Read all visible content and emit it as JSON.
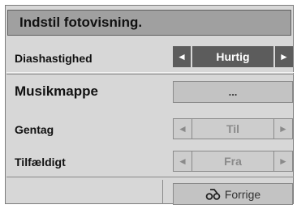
{
  "dialog": {
    "title": "Indstil fotovisning.",
    "slideshow_speed": {
      "label": "Diashastighed",
      "value": "Hurtig",
      "left_arrow": "◄",
      "right_arrow": "►"
    },
    "music_folder": {
      "label": "Musikmappe",
      "button_label": "..."
    },
    "repeat": {
      "label": "Gentag",
      "value": "Til",
      "left_arrow": "◄",
      "right_arrow": "►"
    },
    "random": {
      "label": "Tilfældigt",
      "value": "Fra",
      "left_arrow": "◄",
      "right_arrow": "►"
    },
    "back_button": {
      "icon": "back-icon",
      "label": "Forrige"
    }
  }
}
